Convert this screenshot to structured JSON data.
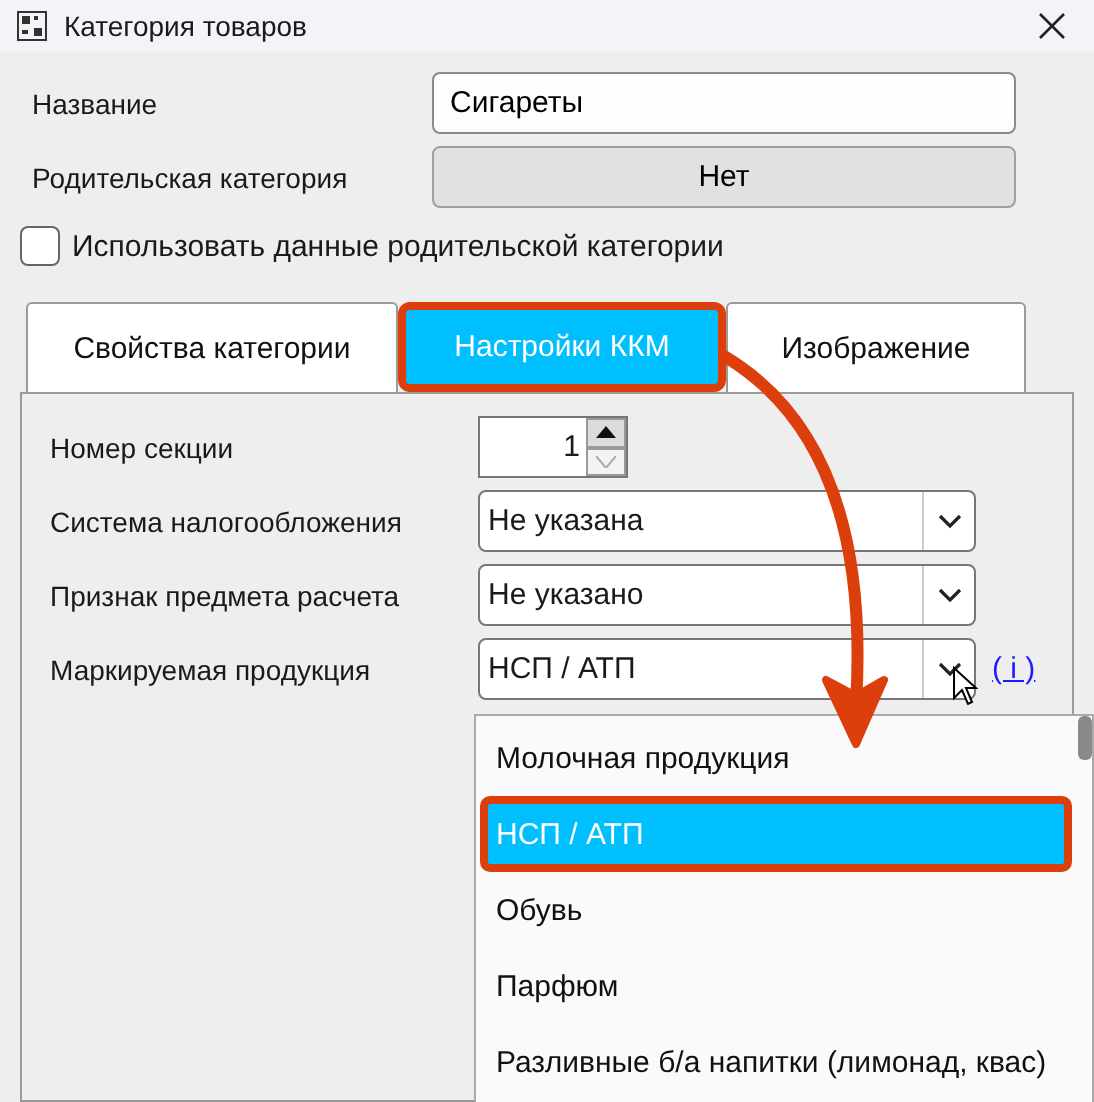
{
  "window": {
    "title": "Категория товаров"
  },
  "fields": [
    {
      "kind": "input",
      "label": "Название",
      "value": "Сигареты"
    },
    {
      "kind": "button",
      "label": "Родительская категория",
      "value": "Нет"
    }
  ],
  "use_parent": {
    "label": "Использовать данные родительской категории",
    "checked": false
  },
  "tabs": [
    {
      "label": "Свойства категории",
      "selected": false
    },
    {
      "label": "Настройки ККМ",
      "selected": true
    },
    {
      "label": "Изображение",
      "selected": false
    }
  ],
  "settings": [
    {
      "kind": "spin",
      "label": "Номер секции",
      "value": "1"
    },
    {
      "kind": "select",
      "label": "Система налогообложения",
      "value": "Не указана"
    },
    {
      "kind": "select",
      "label": "Признак предмета расчета",
      "value": "Не указано"
    },
    {
      "kind": "select",
      "label": "Маркируемая продукция",
      "value": "НСП / АТП",
      "info": "( i )",
      "open": true
    }
  ],
  "dropdown": [
    {
      "label": "Молочная продукция",
      "selected": false
    },
    {
      "label": "НСП / АТП",
      "selected": true
    },
    {
      "label": "Обувь",
      "selected": false
    },
    {
      "label": "Парфюм",
      "selected": false
    },
    {
      "label": "Разливные б/а напитки (лимонад, квас)",
      "selected": false
    }
  ]
}
